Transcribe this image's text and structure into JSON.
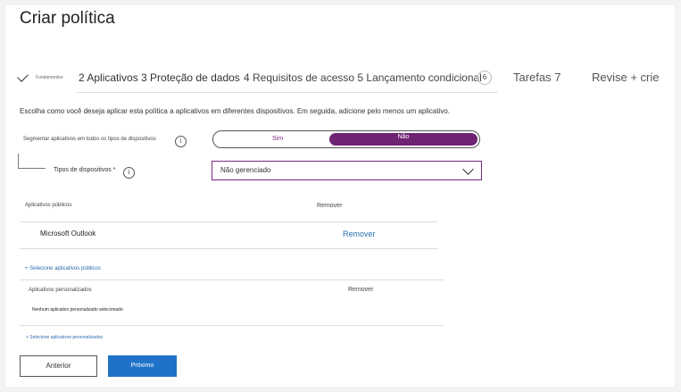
{
  "page": {
    "title": "Criar política"
  },
  "steps": {
    "step1_label": "Fundamentos",
    "step2_3_label": "2 Aplicativos 3 Proteção de dados",
    "step4_5_label": "4 Requisitos de acesso 5 Lançamento condicional",
    "step6_number": "6",
    "step6_label": "Tarefas 7",
    "step7_label": "Revise + crie"
  },
  "description": "Escolha como você deseja aplicar esta política a aplicativos em diferentes dispositivos. Em seguida, adicione pelo menos um aplicativo.",
  "segment": {
    "label": "Segmentar aplicativos em todos os tipos de dispositivos",
    "option_yes": "Sim",
    "option_no": "Não",
    "selected": "Não"
  },
  "device_types": {
    "label": "Tipos de dispositivos *",
    "value": "Não gerenciado"
  },
  "public_apps": {
    "header": "Aplicativos públicos",
    "remove_header": "Remover",
    "items": [
      {
        "name": "Microsoft Outlook",
        "action": "Remover"
      }
    ],
    "add_link": "+ Selecione aplicativos públicos"
  },
  "custom_apps": {
    "header": "Aplicativos personalizados",
    "remove_header": "Remover",
    "empty_text": "Nenhum aplicativo personalizado selecionado",
    "add_link": "+ Selecione aplicativos personalizados"
  },
  "footer": {
    "previous_label": "Anterior",
    "next_label": "Próximo"
  },
  "colors": {
    "accent_purple": "#6e2373",
    "link_blue": "#2b6cb0",
    "primary_button": "#1f72c7"
  },
  "icons": {
    "completed_step": "check-icon",
    "info": "info-icon",
    "dropdown": "chevron-down-icon"
  }
}
